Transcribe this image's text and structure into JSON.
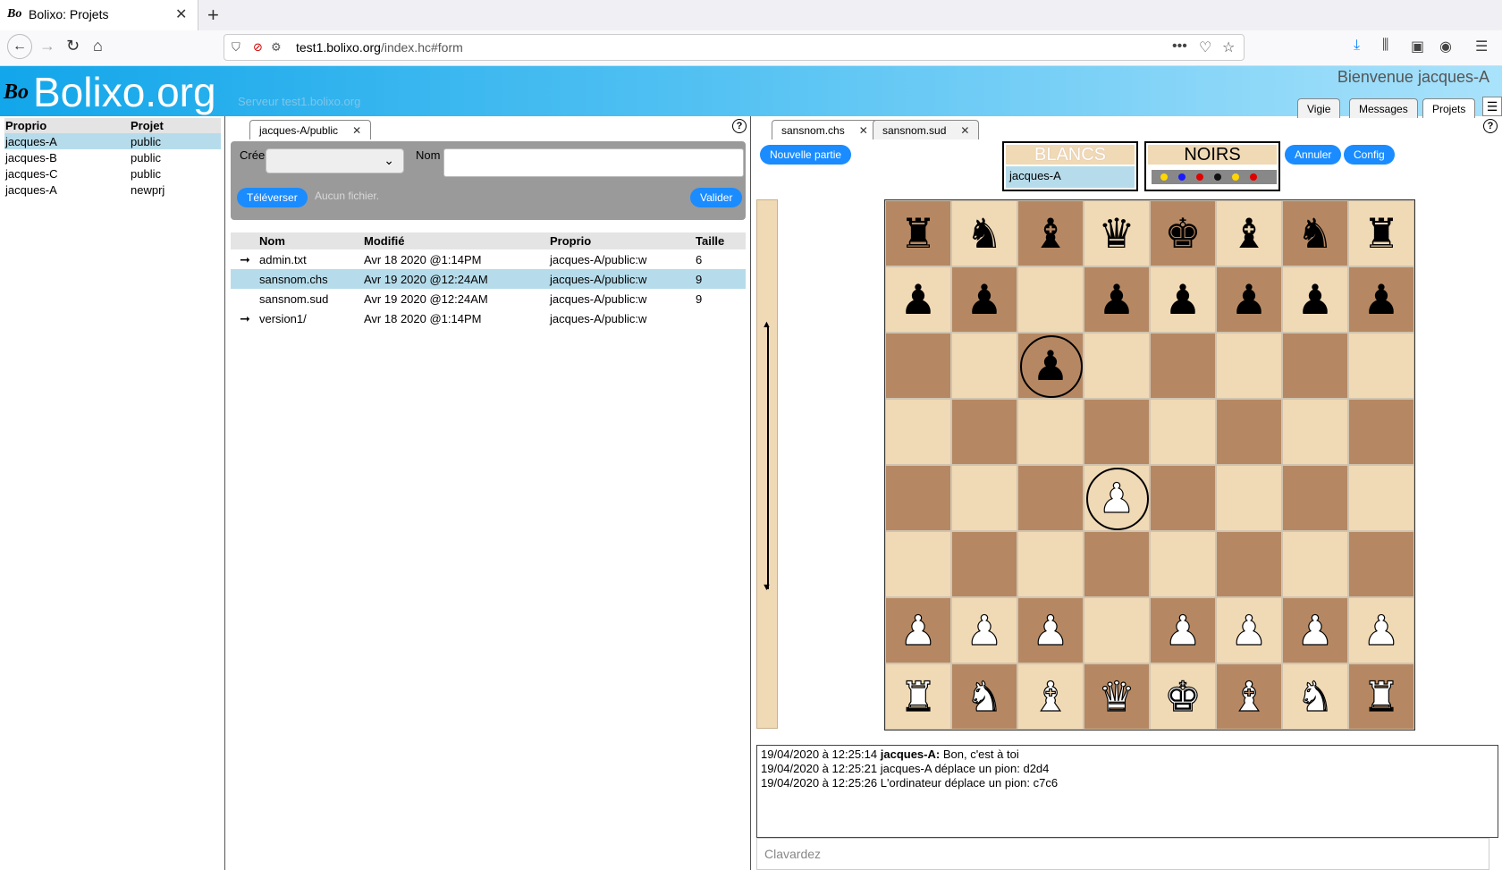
{
  "browser": {
    "tab_icon": "Bo",
    "tab_title": "Bolixo: Projets",
    "url_host": "test1.bolixo.org",
    "url_path": "/index.hc#form"
  },
  "header": {
    "logo_mark": "Bo",
    "brand": "Bolixo.org",
    "server": "Serveur test1.bolixo.org",
    "welcome": "Bienvenue jacques-A",
    "tabs": [
      "Vigie",
      "Messages",
      "Projets"
    ],
    "active_tab": "Projets"
  },
  "projects": {
    "columns": [
      "Proprio",
      "Projet"
    ],
    "rows": [
      [
        "jacques-A",
        "public"
      ],
      [
        "jacques-B",
        "public"
      ],
      [
        "jacques-C",
        "public"
      ],
      [
        "jacques-A",
        "newprj"
      ]
    ],
    "selected_row": 0
  },
  "files": {
    "tab_label": "jacques-A/public",
    "create_label": "Créer",
    "name_label": "Nom",
    "name_value": "",
    "upload_button": "Téléverser",
    "no_file": "Aucun fichier.",
    "validate_button": "Valider",
    "columns": [
      "Nom",
      "Modifié",
      "Proprio",
      "Taille"
    ],
    "rows": [
      {
        "arrow": "➞",
        "name": "admin.txt",
        "modified": "Avr 18 2020 @1:14PM",
        "owner": "jacques-A/public:w",
        "size": "6"
      },
      {
        "arrow": "",
        "name": "sansnom.chs",
        "modified": "Avr 19 2020 @12:24AM",
        "owner": "jacques-A/public:w",
        "size": "9"
      },
      {
        "arrow": "",
        "name": "sansnom.sud",
        "modified": "Avr 19 2020 @12:24AM",
        "owner": "jacques-A/public:w",
        "size": "9"
      },
      {
        "arrow": "➞",
        "name": "version1/",
        "modified": "Avr 18 2020 @1:14PM",
        "owner": "jacques-A/public:w",
        "size": ""
      }
    ],
    "selected_row": 1
  },
  "game": {
    "tabs": [
      "sansnom.chs",
      "sansnom.sud"
    ],
    "new_game_button": "Nouvelle partie",
    "cancel_button": "Annuler",
    "config_button": "Config",
    "white_label": "BLANCS",
    "white_player": "jacques-A",
    "black_label": "NOIRS",
    "black_dots": [
      "#ffd700",
      "#1a1aff",
      "#e00000",
      "#111111",
      "#ffd700",
      "#e00000"
    ],
    "board": [
      [
        "bR",
        "bN",
        "bB",
        "bQ",
        "bK",
        "bB",
        "bN",
        "bR"
      ],
      [
        "bP",
        "bP",
        "",
        "bP",
        "bP",
        "bP",
        "bP",
        "bP"
      ],
      [
        "",
        "",
        "bP",
        "",
        "",
        "",
        "",
        ""
      ],
      [
        "",
        "",
        "",
        "",
        "",
        "",
        "",
        ""
      ],
      [
        "",
        "",
        "",
        "wP",
        "",
        "",
        "",
        ""
      ],
      [
        "",
        "",
        "",
        "",
        "",
        "",
        "",
        ""
      ],
      [
        "wP",
        "wP",
        "wP",
        "",
        "wP",
        "wP",
        "wP",
        "wP"
      ],
      [
        "wR",
        "wN",
        "wB",
        "wQ",
        "wK",
        "wB",
        "wN",
        "wR"
      ]
    ],
    "highlighted_squares": [
      "c6",
      "d4"
    ]
  },
  "chat": {
    "lines": [
      {
        "time": "19/04/2020 à 12:25:14",
        "speaker": "jacques-A:",
        "text": "Bon, c'est à toi"
      },
      {
        "time": "19/04/2020 à 12:25:21",
        "speaker": "",
        "text": "jacques-A déplace un pion: d2d4"
      },
      {
        "time": "19/04/2020 à 12:25:26",
        "speaker": "",
        "text": "L'ordinateur déplace un pion: c7c6"
      }
    ],
    "placeholder": "Clavardez"
  }
}
